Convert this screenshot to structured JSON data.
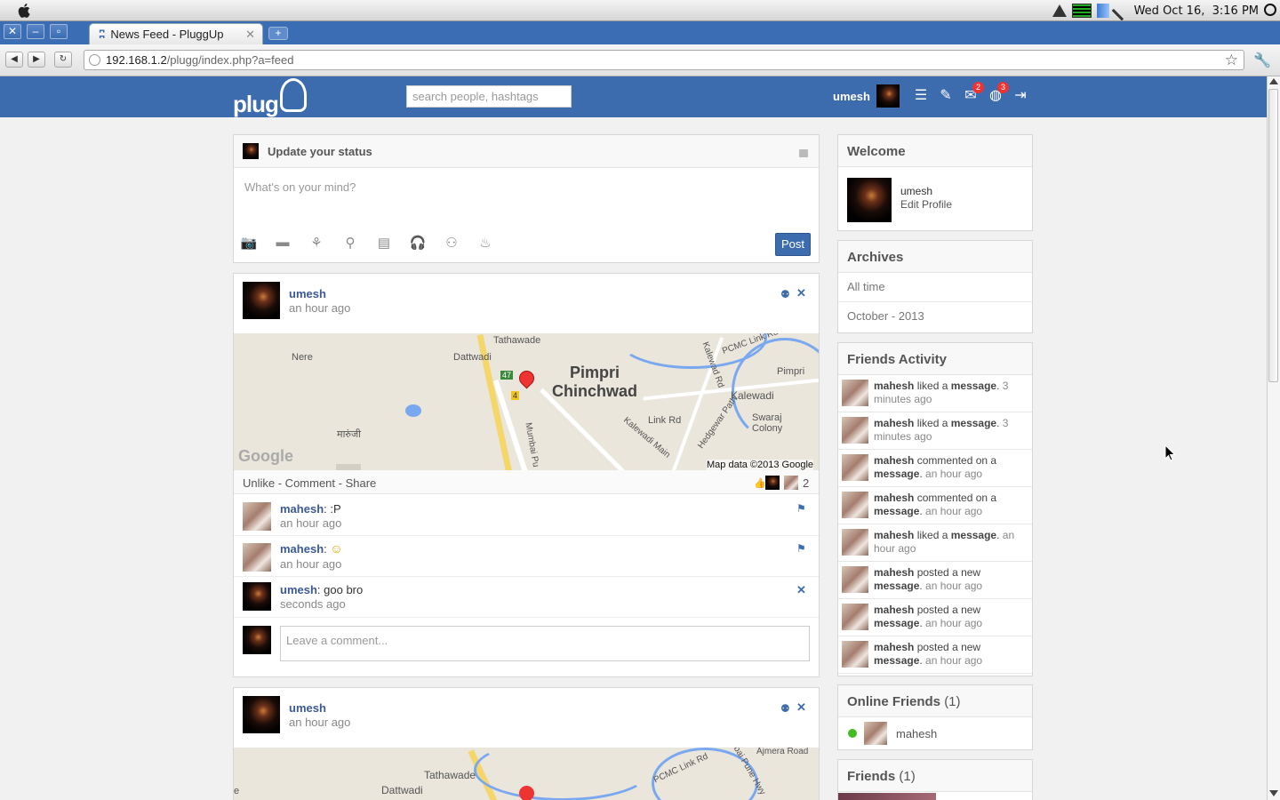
{
  "os": {
    "clock": "Wed Oct 16,  3:16 PM"
  },
  "browser": {
    "tab_title": "News Feed - PluggUp",
    "url_host": "192.168.1.2",
    "url_path": "/plugg/index.php?a=feed"
  },
  "header": {
    "logo": "plug",
    "search_placeholder": "search people, hashtags",
    "username": "umesh",
    "messages_badge": "2",
    "notifications_badge": "3"
  },
  "composer": {
    "title": "Update your status",
    "placeholder": "What's on your mind?",
    "post_label": "Post"
  },
  "posts": [
    {
      "author": "umesh",
      "time": "an hour ago",
      "map": {
        "labels": [
          "Tathawade",
          "Dattwadi",
          "Nere",
          "मारुंजी",
          "Pimpri",
          "Chinchwad",
          "Pimpri",
          "Kalewadi",
          "Swaraj",
          "Colony",
          "Link Rd",
          "Kalewadi Main",
          "Hedgewar Path",
          "Mumbai Pu",
          "Kalewad Rd",
          "PCMC Link Rd",
          "47",
          "4",
          "Google",
          "Map data ©2013 Google"
        ]
      },
      "actions": "Unlike - Comment - Share",
      "like_count": "2",
      "comments": [
        {
          "author": "mahesh",
          "text": ":P",
          "time": "an hour ago"
        },
        {
          "author": "mahesh",
          "text": "☺",
          "time": "an hour ago"
        },
        {
          "author": "umesh",
          "text": "goo bro",
          "time": "seconds ago"
        }
      ],
      "comment_placeholder": "Leave a comment..."
    },
    {
      "author": "umesh",
      "time": "an hour ago",
      "map": {
        "labels": [
          "Tathawade",
          "Dattwadi",
          "PCMC Link Rd",
          "nbai Pune Hwy",
          "Ajmera Road",
          "e"
        ]
      }
    }
  ],
  "sidebar": {
    "welcome": {
      "title": "Welcome",
      "name": "umesh",
      "edit": "Edit Profile"
    },
    "archives": {
      "title": "Archives",
      "items": [
        "All time",
        "October - 2013"
      ]
    },
    "friends_activity": {
      "title": "Friends Activity",
      "items": [
        {
          "who": "mahesh",
          "what": "liked a",
          "obj": "message",
          "time": "3 minutes ago"
        },
        {
          "who": "mahesh",
          "what": "liked a",
          "obj": "message",
          "time": "3 minutes ago"
        },
        {
          "who": "mahesh",
          "what": "commented on a",
          "obj": "message",
          "time": "an hour ago"
        },
        {
          "who": "mahesh",
          "what": "commented on a",
          "obj": "message",
          "time": "an hour ago"
        },
        {
          "who": "mahesh",
          "what": "liked a",
          "obj": "message",
          "time": "an hour ago"
        },
        {
          "who": "mahesh",
          "what": "posted a new",
          "obj": "message",
          "time": "an hour ago"
        },
        {
          "who": "mahesh",
          "what": "posted a new",
          "obj": "message",
          "time": "an hour ago"
        },
        {
          "who": "mahesh",
          "what": "posted a new",
          "obj": "message",
          "time": "an hour ago"
        }
      ]
    },
    "online": {
      "title": "Online Friends",
      "count": "(1)",
      "name": "mahesh"
    },
    "friends": {
      "title": "Friends",
      "count": "(1)"
    }
  },
  "colors": {
    "header": "#3d6cae",
    "link": "#3b5998",
    "online": "#44bb22"
  }
}
